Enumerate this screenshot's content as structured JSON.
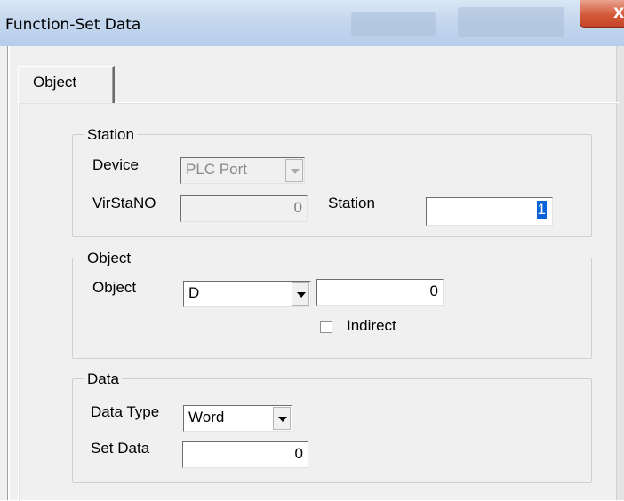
{
  "window": {
    "title": "Function-Set Data",
    "close_glyph": "X"
  },
  "tabs": [
    {
      "label": "Object"
    }
  ],
  "station_group": {
    "legend": "Station",
    "device_label": "Device",
    "device_value": "PLC Port",
    "virstano_label": "VirStaNO",
    "virstano_value": "0",
    "station_label": "Station",
    "station_value": "1"
  },
  "object_group": {
    "legend": "Object",
    "object_label": "Object",
    "object_value": "D",
    "address_value": "0",
    "indirect_label": "Indirect",
    "indirect_checked": false
  },
  "data_group": {
    "legend": "Data",
    "data_type_label": "Data Type",
    "data_type_value": "Word",
    "set_data_label": "Set Data",
    "set_data_value": "0"
  },
  "colors": {
    "selection": "#0a64d8",
    "close_button": "#c6452a",
    "title_bar": "#c4d7ee"
  }
}
